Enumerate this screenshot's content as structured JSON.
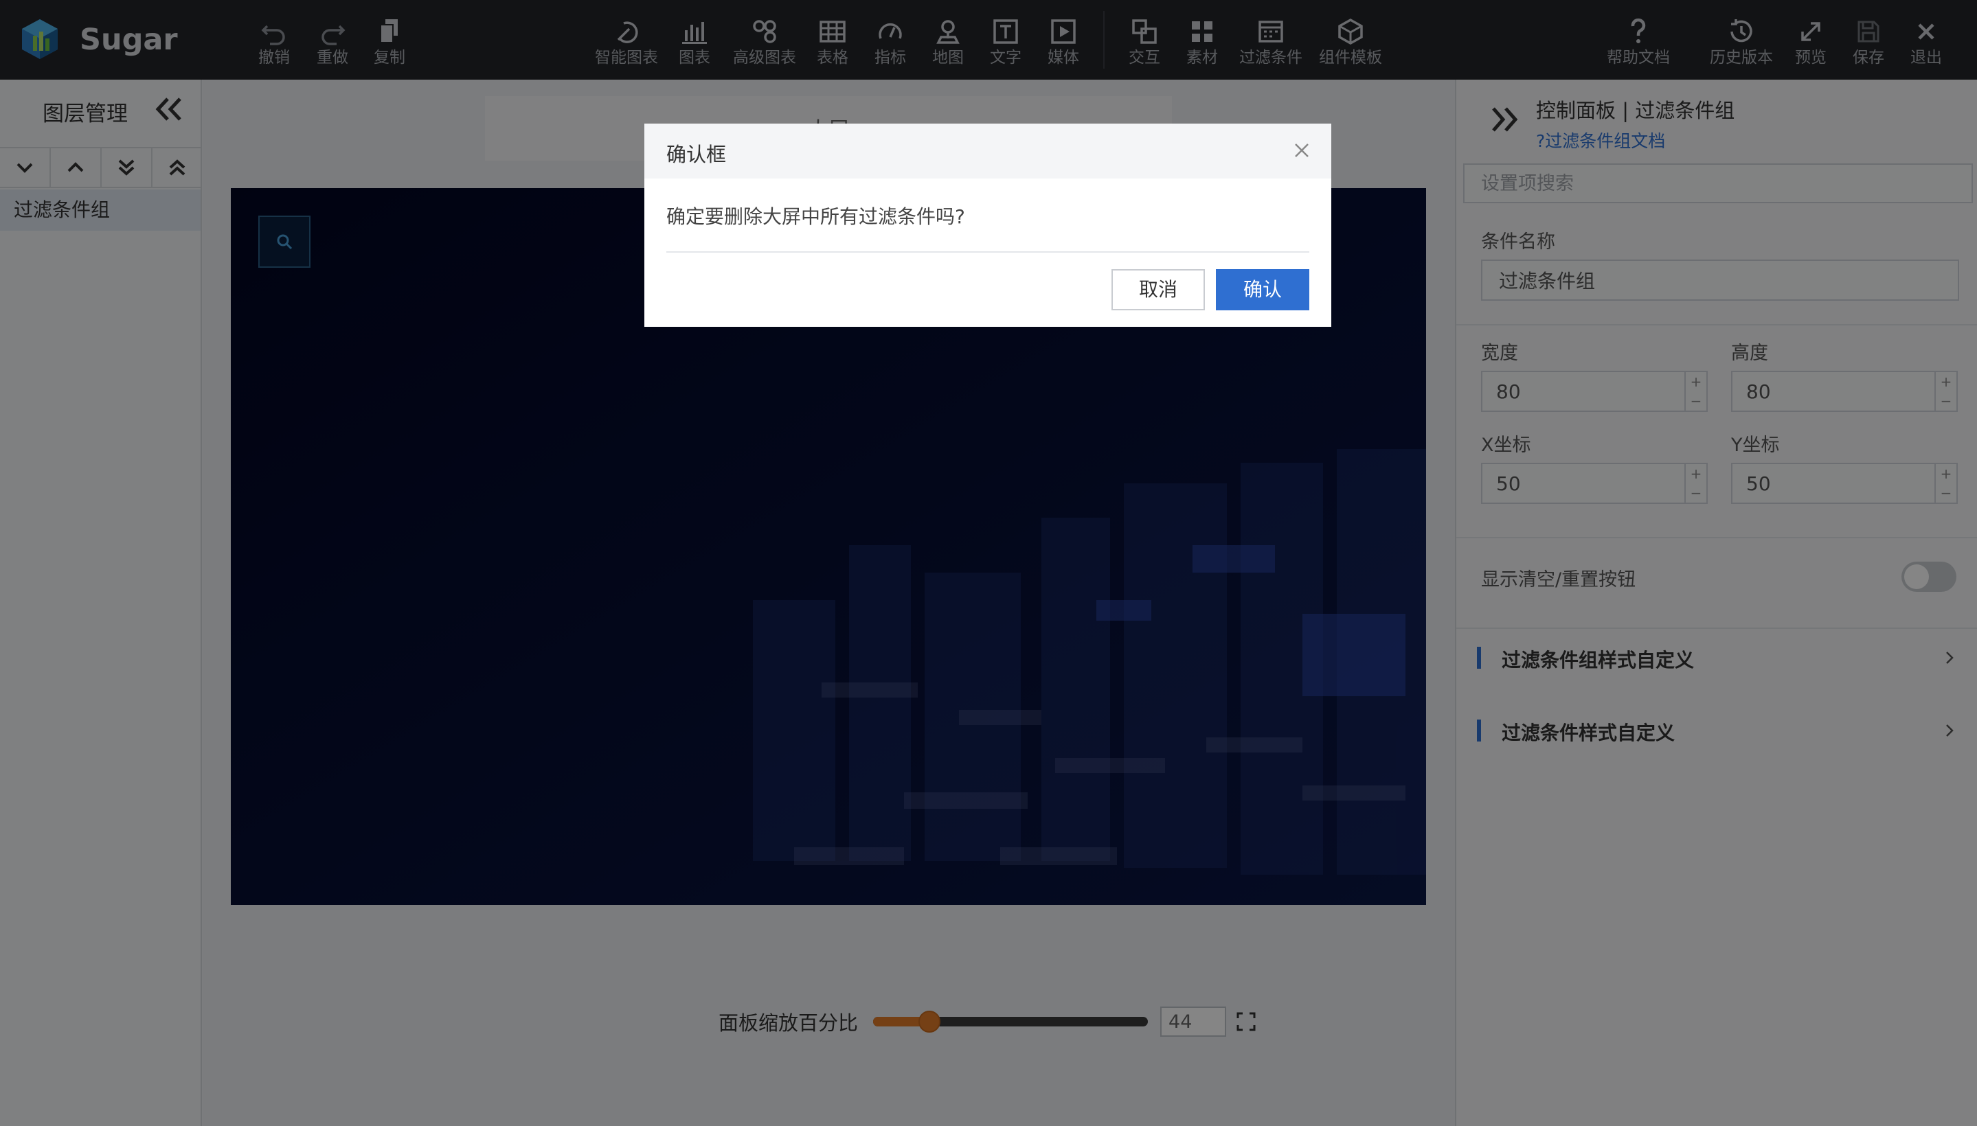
{
  "app": {
    "brand": "Sugar"
  },
  "toolbar": {
    "undo": "撤销",
    "redo": "重做",
    "copy": "复制",
    "smart_chart": "智能图表",
    "chart": "图表",
    "advanced_chart": "高级图表",
    "table": "表格",
    "indicator": "指标",
    "map": "地图",
    "text": "文字",
    "media": "媒体",
    "interaction": "交互",
    "material": "素材",
    "filter": "过滤条件",
    "component_template": "组件模板",
    "help": "帮助文档",
    "history": "历史版本",
    "preview": "预览",
    "save": "保存",
    "exit": "退出"
  },
  "layers": {
    "title": "图层管理",
    "items": [
      "过滤条件组"
    ]
  },
  "canvas": {
    "tab_text": "大屏",
    "zoom_label": "面板缩放百分比",
    "zoom_value": "44",
    "zoom_fraction": 0.18
  },
  "panel": {
    "title": "控制面板 | 过滤条件组",
    "doc_link": "?过滤条件组文档",
    "search_placeholder": "设置项搜索",
    "name_label": "条件名称",
    "name_value": "过滤条件组",
    "width_label": "宽度",
    "width_value": "80",
    "height_label": "高度",
    "height_value": "80",
    "x_label": "X坐标",
    "x_value": "50",
    "y_label": "Y坐标",
    "y_value": "50",
    "stepper_plus": "+",
    "stepper_minus": "−",
    "toggle_label": "显示清空/重置按钮",
    "section1": "过滤条件组样式自定义",
    "section2": "过滤条件样式自定义"
  },
  "modal": {
    "title": "确认框",
    "message": "确定要删除大屏中所有过滤条件吗?",
    "cancel": "取消",
    "confirm": "确认"
  },
  "colors": {
    "accent": "#2f6fd1",
    "toolbar_bg": "#23252a",
    "slider": "#e07b2a",
    "screen_bg": "#020622"
  }
}
